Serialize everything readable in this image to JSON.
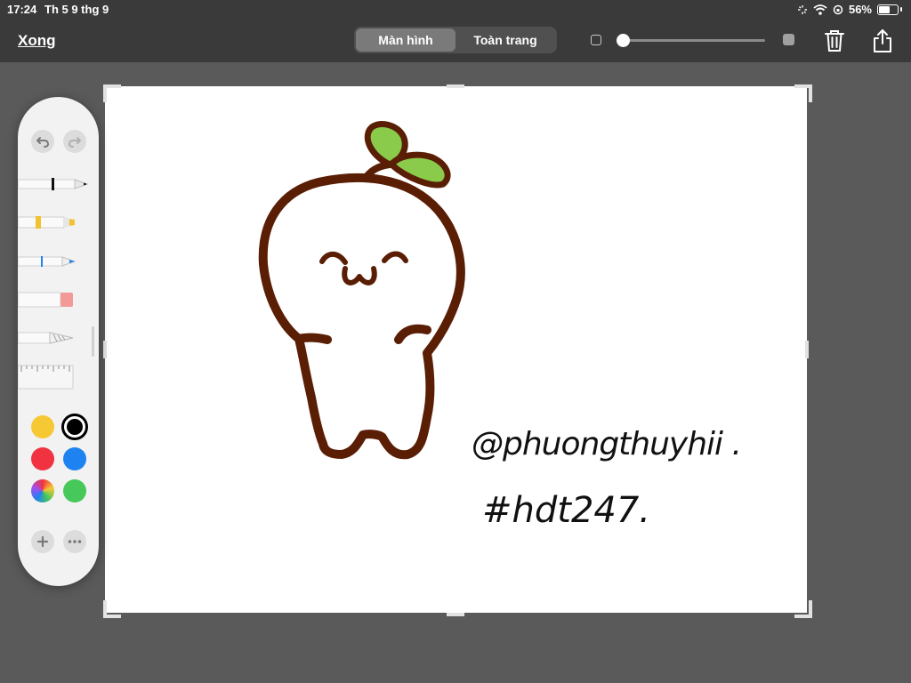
{
  "status_bar": {
    "time": "17:24",
    "date": "Th 5 9 thg 9",
    "battery": "56%"
  },
  "toolbar": {
    "done_label": "Xong",
    "segments": [
      "Màn hình",
      "Toàn trang"
    ],
    "active_segment": "Màn hình",
    "brush_size_level": 0.0
  },
  "canvas": {
    "handle_text": "@phuongthuyhii .",
    "tag_text": "#hdt247."
  },
  "palette": {
    "colors": {
      "yellow": "#f6c833",
      "black": "#000000",
      "red": "#f03241",
      "blue": "#1e82f0",
      "green": "#46c85a"
    },
    "selected_color": "black",
    "tools": [
      "pen",
      "marker",
      "pencil",
      "eraser",
      "lasso",
      "ruler"
    ]
  },
  "icons": {
    "undo": "undo-icon",
    "redo": "redo-icon",
    "trash": "trash-icon",
    "share": "share-icon",
    "add": "plus-icon",
    "more": "ellipsis-icon"
  }
}
